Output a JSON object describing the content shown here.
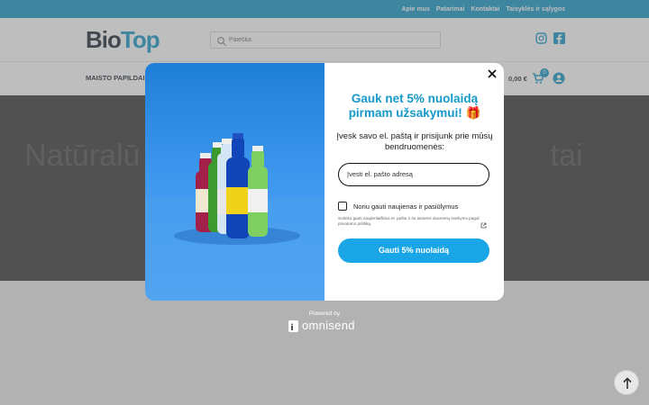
{
  "topbar": {
    "links": [
      "Apie mus",
      "Patarimai",
      "Kontaktai",
      "Taisyklės ir sąlygos"
    ]
  },
  "header": {
    "logo": {
      "part1": "Bio",
      "part2": "Top"
    },
    "search": {
      "placeholder": "Paieška"
    }
  },
  "nav": {
    "menu_label": "MAISTO PAPILDAI",
    "cart_total": "0,00 €",
    "cart_count": "0"
  },
  "hero": {
    "title_left": "Natūralū",
    "title_right": "tai"
  },
  "popup": {
    "heading": "Gauk net 5% nuolaidą pirmam užsakymui! 🎁",
    "subheading": "Įvesk savo el. paštą ir prisijunk prie mūsų bendruomenės:",
    "email_placeholder": "Įvesti el. pašto adresą",
    "checkbox_label": "Noriu gauti naujienas ir pasiūlymus",
    "consent_text": "Sutinku gauti naujienlaiškius el. paštu ir su asmens duomenų tvarkymu pagal privatumo politiką.",
    "cta_label": "Gauti 5% nuolaidą"
  },
  "footer_brand": {
    "powered_by": "Powered by",
    "name": "omnisend"
  },
  "colors": {
    "accent": "#1699c8",
    "cta": "#1aa6e6",
    "hero_bg": "#3a3a3a"
  }
}
